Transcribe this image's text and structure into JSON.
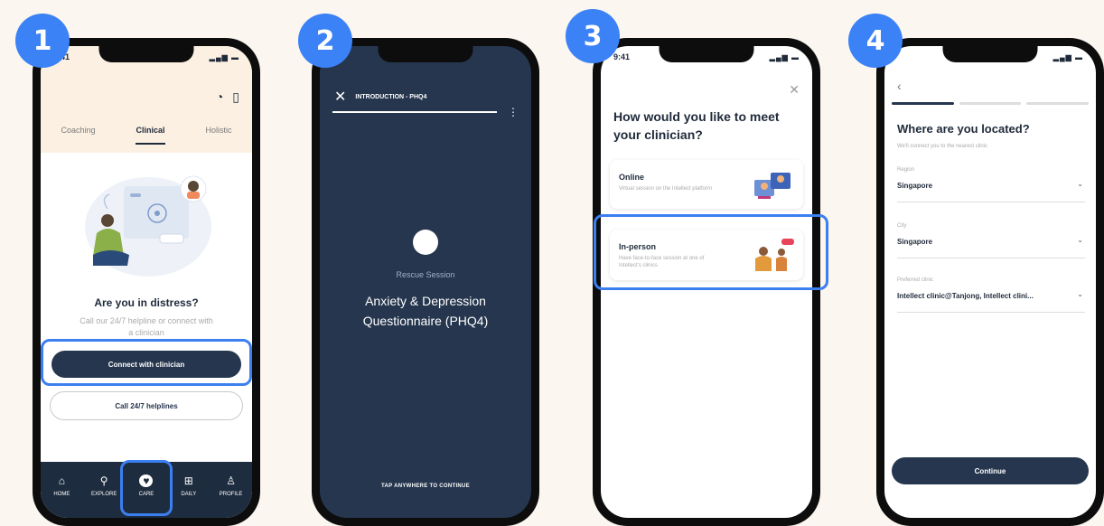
{
  "colors": {
    "accent_blue": "#3b82f6",
    "navy": "#25364e",
    "background": "#fbf6ef"
  },
  "steps": [
    "1",
    "2",
    "3",
    "4"
  ],
  "screen1": {
    "time": "9:41",
    "tabs": [
      "Coaching",
      "Clinical",
      "Holistic"
    ],
    "heading": "Are you in distress?",
    "subtext": "Call our 24/7 helpline or connect with a clinician",
    "primary_button": "Connect with clinician",
    "secondary_button": "Call 24/7 helplines",
    "nav": [
      "HOME",
      "EXPLORE",
      "CARE",
      "DAILY",
      "PROFILE"
    ]
  },
  "screen2": {
    "header": "INTRODUCTION - PHQ4",
    "label": "Rescue Session",
    "title": "Anxiety & Depression Questionnaire (PHQ4)",
    "footer": "TAP ANYWHERE TO CONTINUE"
  },
  "screen3": {
    "time": "9:41",
    "title": "How would you like to meet your clinician?",
    "options": [
      {
        "title": "Online",
        "desc": "Virtual session on the Intellect platform"
      },
      {
        "title": "In-person",
        "desc": "Have face-to-face session at one of Intellect's clinics"
      }
    ]
  },
  "screen4": {
    "title": "Where are you located?",
    "subtitle": "We'll connect you to the nearest clinic",
    "fields": [
      {
        "label": "Region",
        "value": "Singapore"
      },
      {
        "label": "City",
        "value": "Singapore"
      },
      {
        "label": "Preferred clinic",
        "value": "Intellect clinic@Tanjong, Intellect clini..."
      }
    ],
    "button": "Continue"
  }
}
